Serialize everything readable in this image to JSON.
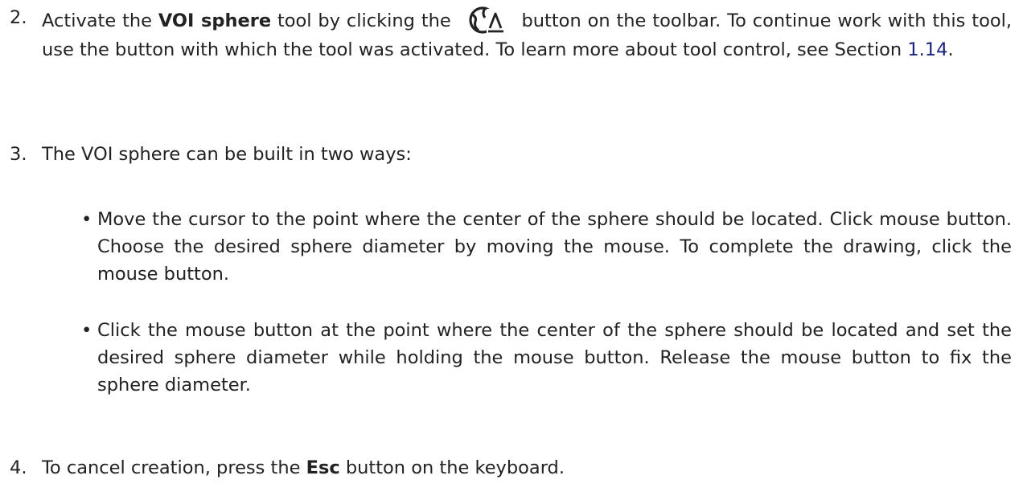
{
  "steps": [
    {
      "number": "2.",
      "segments": {
        "a": "Activate the ",
        "b_bold": "VOI sphere",
        "c": " tool by clicking the ",
        "d": " button on the toolbar. To continue work with this tool, use the button with which the tool was activated. To learn more about tool control, see Section ",
        "e_link": "1.14",
        "f": "."
      },
      "icon": "voi-sphere-tool-icon"
    },
    {
      "number": "3.",
      "text": "The VOI sphere can be built in two ways:",
      "bullets": [
        {
          "marker": "•",
          "text": "Move the cursor to the point where the center of the sphere should be located. Click mouse button. Choose the desired sphere diameter by moving the mouse. To complete the drawing, click the mouse button."
        },
        {
          "marker": "•",
          "text": "Click the mouse button at the point where the center of the sphere should be lo­cated and set the desired sphere diameter while holding the mouse button. Re­lease the mouse button to fix the sphere diameter."
        }
      ]
    },
    {
      "number": "4.",
      "segments": {
        "a": "To cancel creation, press the ",
        "b_bold": "Esc",
        "c": " button on the keyboard."
      }
    }
  ],
  "colors": {
    "text": "#222222",
    "link": "#1a237e"
  }
}
